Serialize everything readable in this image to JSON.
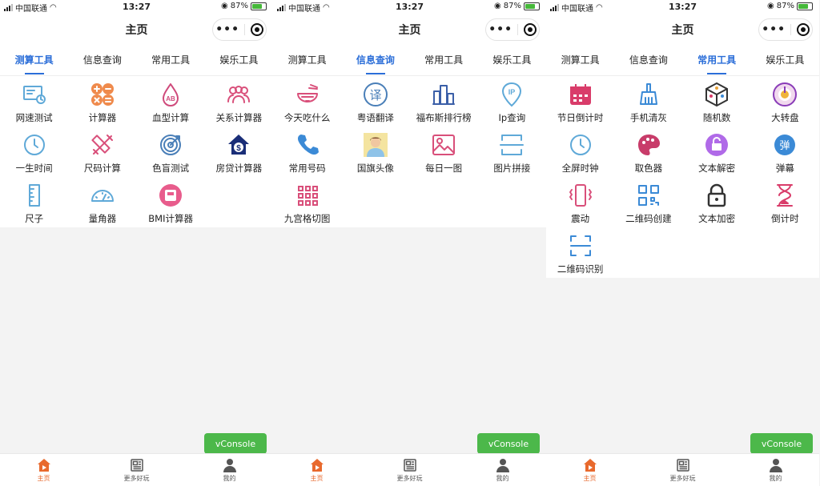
{
  "status": {
    "carrier": "中国联通",
    "time": "13:27",
    "battery": "87%"
  },
  "nav": {
    "title": "主页"
  },
  "tabs": [
    "测算工具",
    "信息查询",
    "常用工具",
    "娱乐工具"
  ],
  "screens": [
    {
      "active_tab": 0,
      "items": [
        {
          "label": "网速测试",
          "icon": "speed-test-icon",
          "color": "#5fa9d8"
        },
        {
          "label": "计算器",
          "icon": "calculator-icon",
          "color": "#ef8a4c"
        },
        {
          "label": "血型计算",
          "icon": "blood-type-icon",
          "color": "#cf4a7b"
        },
        {
          "label": "关系计算器",
          "icon": "people-icon",
          "color": "#d94f7a"
        },
        {
          "label": "一生时间",
          "icon": "clock-icon",
          "color": "#5fa9d8"
        },
        {
          "label": "尺码计算",
          "icon": "ruler-pencil-icon",
          "color": "#d94f7a"
        },
        {
          "label": "色盲测试",
          "icon": "target-icon",
          "color": "#4a7fb8"
        },
        {
          "label": "房贷计算器",
          "icon": "house-dollar-icon",
          "color": "#1a2e78"
        },
        {
          "label": "尺子",
          "icon": "ruler-icon",
          "color": "#5fa9d8"
        },
        {
          "label": "量角器",
          "icon": "protractor-icon",
          "color": "#5fa9d8"
        },
        {
          "label": "BMI计算器",
          "icon": "scale-icon",
          "color": "#e85c8c"
        }
      ]
    },
    {
      "active_tab": 1,
      "items": [
        {
          "label": "今天吃什么",
          "icon": "bowl-icon",
          "color": "#d94f7a"
        },
        {
          "label": "粤语翻译",
          "icon": "translate-icon",
          "color": "#4a7fb8"
        },
        {
          "label": "福布斯排行榜",
          "icon": "buildings-icon",
          "color": "#3b5fa8"
        },
        {
          "label": "Ip查询",
          "icon": "ip-icon",
          "color": "#5fa9d8"
        },
        {
          "label": "常用号码",
          "icon": "phone-icon",
          "color": "#3b8ad6"
        },
        {
          "label": "国旗头像",
          "icon": "avatar-icon",
          "color": "#e8c04a"
        },
        {
          "label": "每日一图",
          "icon": "image-icon",
          "color": "#d94f7a"
        },
        {
          "label": "图片拼接",
          "icon": "stitch-icon",
          "color": "#5fa9d8"
        },
        {
          "label": "九宫格切图",
          "icon": "grid-icon",
          "color": "#d94f7a"
        }
      ]
    },
    {
      "active_tab": 2,
      "items": [
        {
          "label": "节日倒计时",
          "icon": "calendar-icon",
          "color": "#d93c6a"
        },
        {
          "label": "手机清灰",
          "icon": "broom-icon",
          "color": "#3b8ad6"
        },
        {
          "label": "随机数",
          "icon": "dice-icon",
          "color": "#e8a43c"
        },
        {
          "label": "大转盘",
          "icon": "wheel-icon",
          "color": "#8a3cb8"
        },
        {
          "label": "全屏时钟",
          "icon": "clock-icon",
          "color": "#5fa9d8"
        },
        {
          "label": "取色器",
          "icon": "palette-icon",
          "color": "#c83c6a"
        },
        {
          "label": "文本解密",
          "icon": "unlock-icon",
          "color": "#b06ae8"
        },
        {
          "label": "弹幕",
          "icon": "danmaku-icon",
          "color": "#3b8ad6"
        },
        {
          "label": "震动",
          "icon": "vibrate-icon",
          "color": "#d94f7a"
        },
        {
          "label": "二维码创建",
          "icon": "qrcode-icon",
          "color": "#3b8ad6"
        },
        {
          "label": "文本加密",
          "icon": "lock-icon",
          "color": "#333333"
        },
        {
          "label": "倒计时",
          "icon": "hourglass-icon",
          "color": "#d93c6a"
        },
        {
          "label": "二维码识别",
          "icon": "scan-icon",
          "color": "#3b8ad6"
        }
      ]
    }
  ],
  "vconsole": "vConsole",
  "tabbar": [
    {
      "label": "主页",
      "icon": "home-icon"
    },
    {
      "label": "更多好玩",
      "icon": "news-icon"
    },
    {
      "label": "我的",
      "icon": "user-icon"
    }
  ],
  "danmaku_char": "弹",
  "translate_char": "译",
  "ip_text": "IP",
  "ab_text": "AB"
}
